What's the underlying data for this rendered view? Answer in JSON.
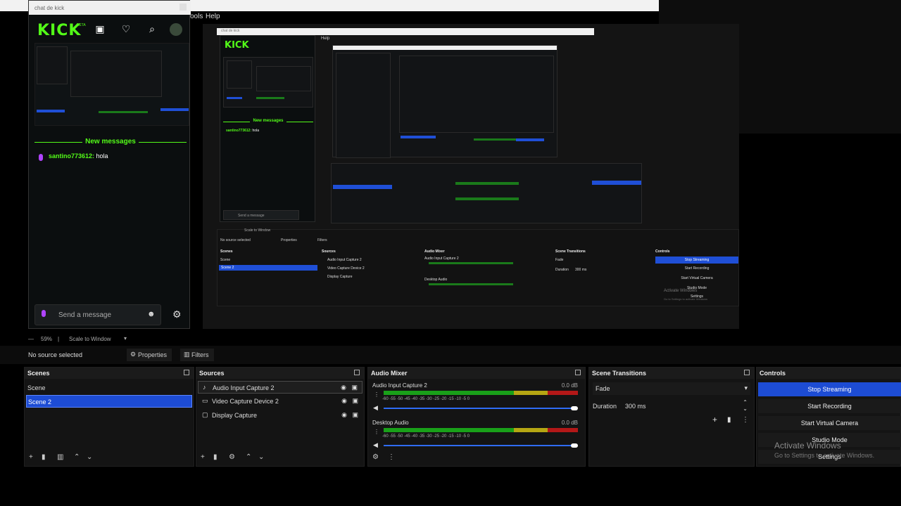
{
  "chat": {
    "window_title": "chat de kick",
    "logo": "KICK",
    "logo_badge": "BETA",
    "new_messages": "New messages",
    "message_user": "santino773612:",
    "message_text": " hola",
    "input_placeholder": "Send a message",
    "mini_new_messages": "New messages",
    "mini_user": "santino773612:",
    "mini_text": " hola",
    "mini_placeholder": "Send a message"
  },
  "menu": {
    "tools_partial": "ools",
    "help": "Help"
  },
  "toolbar": {
    "zoom": "59%",
    "scale": "Scale to Window"
  },
  "source_bar": {
    "status": "No source selected",
    "properties": "Properties",
    "filters": "Filters"
  },
  "scenes": {
    "title": "Scenes",
    "items": [
      {
        "label": "Scene"
      },
      {
        "label": "Scene 2"
      }
    ]
  },
  "sources": {
    "title": "Sources",
    "items": [
      {
        "label": "Audio Input Capture 2"
      },
      {
        "label": "Video Capture Device 2"
      },
      {
        "label": "Display Capture"
      }
    ]
  },
  "mixer": {
    "title": "Audio Mixer",
    "ticks": "-60  -55  -50  -45  -40  -35  -30  -25  -20  -15  -10  -5  0",
    "channels": [
      {
        "name": "Audio Input Capture 2",
        "level": "0.0 dB",
        "volume": 1.0
      },
      {
        "name": "Desktop Audio",
        "level": "0.0 dB",
        "volume": 1.0
      }
    ]
  },
  "transitions": {
    "title": "Scene Transitions",
    "selected": "Fade",
    "duration_label": "Duration",
    "duration_value": "300 ms"
  },
  "controls": {
    "title": "Controls",
    "buttons": [
      {
        "label": "Stop Streaming",
        "active": true
      },
      {
        "label": "Start Recording",
        "active": false
      },
      {
        "label": "Start Virtual Camera",
        "active": false
      },
      {
        "label": "Studio Mode",
        "active": false
      },
      {
        "label": "Settings",
        "active": false
      }
    ]
  },
  "watermark": {
    "title": "Activate Windows",
    "subtitle": "Go to Settings to activate Windows."
  },
  "nested": {
    "status": "No source selected",
    "properties": "Properties",
    "filters": "Filters",
    "scenes_title": "Scenes",
    "sources_title": "Sources",
    "mixer_title": "Audio Mixer",
    "transitions_title": "Scene Transitions",
    "controls_title": "Controls",
    "scene1": "Scene",
    "scene2": "Scene 2",
    "src1": "Audio Input Capture 2",
    "src2": "Video Capture Device 2",
    "src3": "Display Capture",
    "mix1": "Audio Input Capture 2",
    "mix2": "Desktop Audio",
    "fade": "Fade",
    "duration": "Duration",
    "duration_value": "300 ms",
    "stop": "Stop Streaming",
    "rec": "Start Recording",
    "vcam": "Start Virtual Camera",
    "studio": "Studio Mode",
    "settings": "Settings",
    "activate": "Activate Windows",
    "activate_sub": "Go to Settings to activate Windows",
    "chat_title": "chat de kick",
    "help": "Help",
    "scale": "Scale to Window"
  },
  "colors": {
    "kick_green": "#53fc18",
    "obs_blue": "#1d4cd4",
    "meter_green": "#19a019",
    "meter_yellow": "#b5a613",
    "meter_red": "#b31818"
  }
}
